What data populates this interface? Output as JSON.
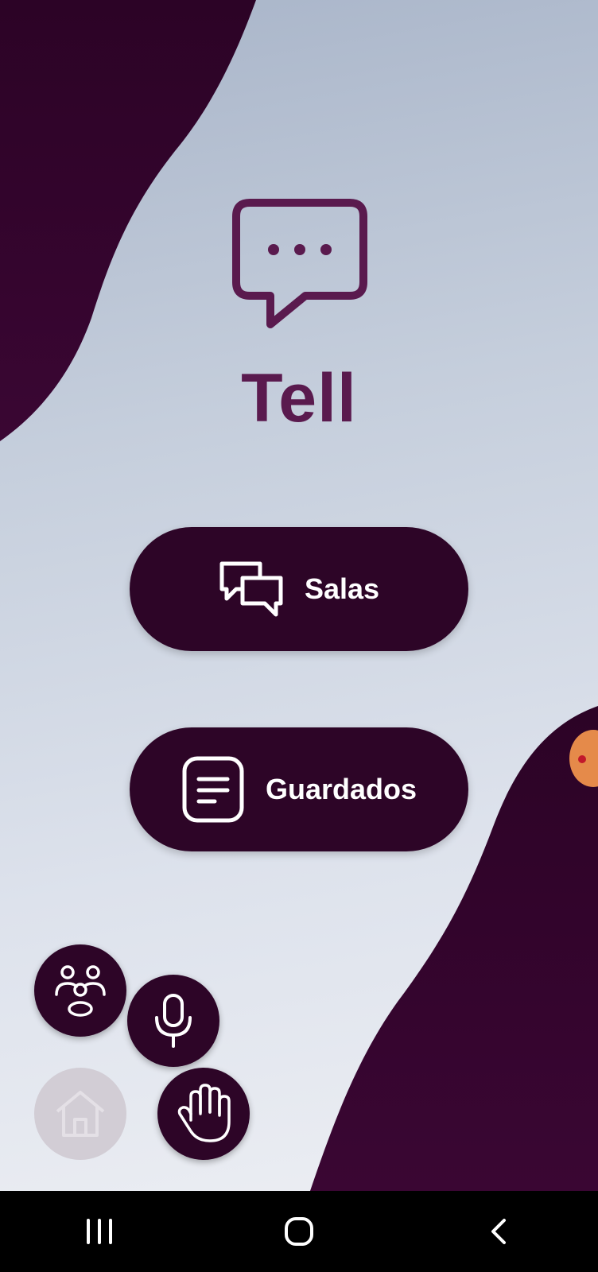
{
  "app": {
    "title": "Tell",
    "logo_icon": "chat-bubble-dots-icon",
    "brand_color": "#5a1a4e",
    "button_color": "#2d0527"
  },
  "menu": {
    "salas": {
      "label": "Salas",
      "icon": "chat-bubbles-icon"
    },
    "guardados": {
      "label": "Guardados",
      "icon": "document-icon"
    }
  },
  "accessibility_fabs": [
    {
      "icon": "people-icon"
    },
    {
      "icon": "microphone-icon"
    },
    {
      "icon": "home-icon",
      "state": "disabled"
    },
    {
      "icon": "hand-icon"
    }
  ],
  "system_nav": {
    "recents_icon": "recents-icon",
    "home_icon": "home-circle-icon",
    "back_icon": "back-chevron-icon"
  }
}
